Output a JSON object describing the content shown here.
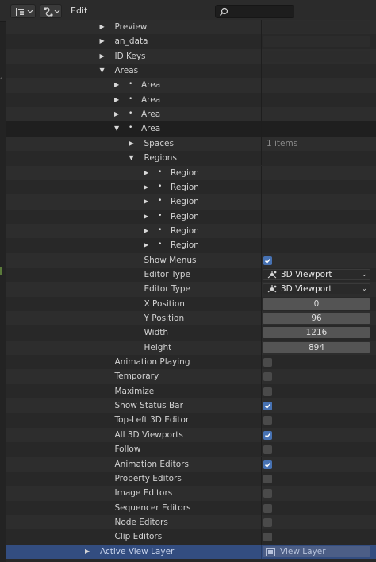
{
  "header": {
    "edit_menu": "Edit",
    "search_placeholder": ""
  },
  "rows": [
    {
      "indent": 3,
      "tri": "right",
      "dot": false,
      "label": "Preview",
      "kind": "field"
    },
    {
      "indent": 3,
      "tri": "right",
      "dot": false,
      "label": "an_data",
      "kind": "field"
    },
    {
      "indent": 3,
      "tri": "right",
      "dot": false,
      "label": "ID Keys",
      "kind": "field"
    },
    {
      "indent": 3,
      "tri": "down",
      "dot": false,
      "label": "Areas",
      "kind": "none"
    },
    {
      "indent": 4,
      "tri": "right",
      "dot": true,
      "label": "Area",
      "kind": "none"
    },
    {
      "indent": 4,
      "tri": "right",
      "dot": true,
      "label": "Area",
      "kind": "none"
    },
    {
      "indent": 4,
      "tri": "right",
      "dot": true,
      "label": "Area",
      "kind": "none"
    },
    {
      "indent": 4,
      "tri": "down",
      "dot": true,
      "label": "Area",
      "kind": "none",
      "active": true
    },
    {
      "indent": 5,
      "tri": "right",
      "dot": false,
      "label": "Spaces",
      "kind": "text",
      "value": "1 items"
    },
    {
      "indent": 5,
      "tri": "down",
      "dot": false,
      "label": "Regions",
      "kind": "none"
    },
    {
      "indent": 6,
      "tri": "right",
      "dot": true,
      "label": "Region",
      "kind": "none"
    },
    {
      "indent": 6,
      "tri": "right",
      "dot": true,
      "label": "Region",
      "kind": "none"
    },
    {
      "indent": 6,
      "tri": "right",
      "dot": true,
      "label": "Region",
      "kind": "none"
    },
    {
      "indent": 6,
      "tri": "right",
      "dot": true,
      "label": "Region",
      "kind": "none"
    },
    {
      "indent": 6,
      "tri": "right",
      "dot": true,
      "label": "Region",
      "kind": "none"
    },
    {
      "indent": 6,
      "tri": "right",
      "dot": true,
      "label": "Region",
      "kind": "none"
    },
    {
      "indent": 5,
      "tri": "",
      "dot": false,
      "label": "Show Menus",
      "kind": "check",
      "checked": true
    },
    {
      "indent": 5,
      "tri": "",
      "dot": false,
      "label": "Editor Type",
      "kind": "enum",
      "value": "3D Viewport"
    },
    {
      "indent": 5,
      "tri": "",
      "dot": false,
      "label": "Editor Type",
      "kind": "enum",
      "value": "3D Viewport"
    },
    {
      "indent": 5,
      "tri": "",
      "dot": false,
      "label": "X Position",
      "kind": "num",
      "value": "0"
    },
    {
      "indent": 5,
      "tri": "",
      "dot": false,
      "label": "Y Position",
      "kind": "num",
      "value": "96"
    },
    {
      "indent": 5,
      "tri": "",
      "dot": false,
      "label": "Width",
      "kind": "num",
      "value": "1216"
    },
    {
      "indent": 5,
      "tri": "",
      "dot": false,
      "label": "Height",
      "kind": "num",
      "value": "894"
    },
    {
      "indent": 3,
      "tri": "",
      "dot": false,
      "label": "Animation Playing",
      "kind": "check",
      "checked": false
    },
    {
      "indent": 3,
      "tri": "",
      "dot": false,
      "label": "Temporary",
      "kind": "check",
      "checked": false
    },
    {
      "indent": 3,
      "tri": "",
      "dot": false,
      "label": "Maximize",
      "kind": "check",
      "checked": false
    },
    {
      "indent": 3,
      "tri": "",
      "dot": false,
      "label": "Show Status Bar",
      "kind": "check",
      "checked": true
    },
    {
      "indent": 3,
      "tri": "",
      "dot": false,
      "label": "Top-Left 3D Editor",
      "kind": "check",
      "checked": false
    },
    {
      "indent": 3,
      "tri": "",
      "dot": false,
      "label": "All 3D Viewports",
      "kind": "check",
      "checked": true
    },
    {
      "indent": 3,
      "tri": "",
      "dot": false,
      "label": "Follow",
      "kind": "check",
      "checked": false
    },
    {
      "indent": 3,
      "tri": "",
      "dot": false,
      "label": "Animation Editors",
      "kind": "check",
      "checked": true
    },
    {
      "indent": 3,
      "tri": "",
      "dot": false,
      "label": "Property Editors",
      "kind": "check",
      "checked": false
    },
    {
      "indent": 3,
      "tri": "",
      "dot": false,
      "label": "Image Editors",
      "kind": "check",
      "checked": false
    },
    {
      "indent": 3,
      "tri": "",
      "dot": false,
      "label": "Sequencer Editors",
      "kind": "check",
      "checked": false
    },
    {
      "indent": 3,
      "tri": "",
      "dot": false,
      "label": "Node Editors",
      "kind": "check",
      "checked": false
    },
    {
      "indent": 3,
      "tri": "",
      "dot": false,
      "label": "Clip Editors",
      "kind": "check",
      "checked": false
    },
    {
      "indent": 2,
      "tri": "right",
      "dot": false,
      "label": "Active View Layer",
      "kind": "viewlayer",
      "value": "View Layer",
      "selected": true
    }
  ],
  "colors": {
    "accent": "#4772b3",
    "selected_row": "#334d80"
  },
  "icons": {
    "display_mode": "outliner-display-mode-icon",
    "filter": "filter-icon",
    "search": "search-icon",
    "editor_type": "3d-viewport-icon",
    "view_layer": "view-layer-icon"
  }
}
